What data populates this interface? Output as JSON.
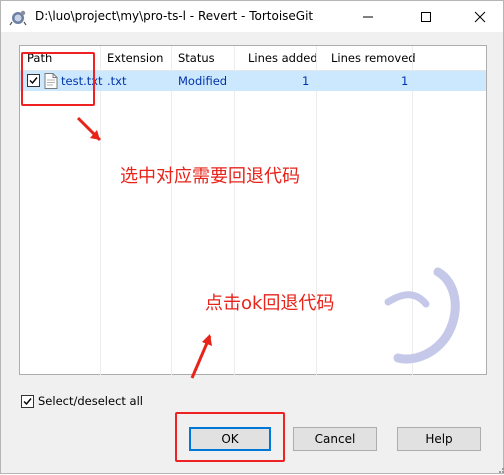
{
  "window": {
    "title": "D:\\luo\\project\\my\\pro-ts-l - Revert - TortoiseGit",
    "minimize_icon": "minimize-icon",
    "maximize_icon": "maximize-icon",
    "close_icon": "close-icon"
  },
  "columns": [
    {
      "label": "Path"
    },
    {
      "label": "Extension"
    },
    {
      "label": "Status"
    },
    {
      "label": "Lines added"
    },
    {
      "label": "Lines removed"
    }
  ],
  "rows": [
    {
      "checked": true,
      "path": "test.txt",
      "extension": ".txt",
      "status": "Modified",
      "lines_added": "1",
      "lines_removed": "1"
    }
  ],
  "select_all": {
    "label": "Select/deselect all",
    "checked": true
  },
  "buttons": {
    "ok": "OK",
    "cancel": "Cancel",
    "help": "Help"
  },
  "annotations": {
    "select_text": "选中对应需要回退代码",
    "click_text": "点击ok回退代码",
    "color": "#e8231a"
  },
  "colors": {
    "selection": "#cce8ff",
    "accent": "#0078d7",
    "link_text": "#0033aa"
  }
}
